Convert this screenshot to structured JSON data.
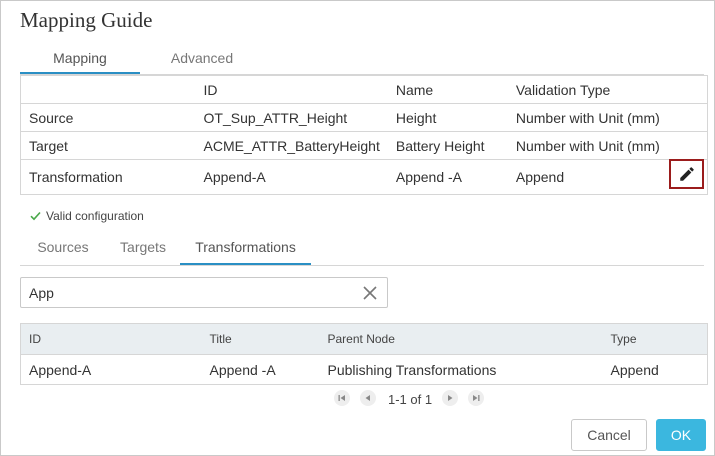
{
  "dialog": {
    "title": "Mapping Guide"
  },
  "top_tabs": [
    {
      "label": "Mapping",
      "active": true
    },
    {
      "label": "Advanced",
      "active": false
    }
  ],
  "summary": {
    "headers": [
      "",
      "ID",
      "Name",
      "Validation Type"
    ],
    "rows": [
      {
        "label": "Source",
        "id": "OT_Sup_ATTR_Height",
        "name": "Height",
        "validation": "Number with Unit (mm)"
      },
      {
        "label": "Target",
        "id": "ACME_ATTR_BatteryHeight",
        "name": "Battery Height",
        "validation": "Number with Unit (mm)"
      },
      {
        "label": "Transformation",
        "id": "Append-A",
        "name": "Append -A",
        "validation": "Append"
      }
    ],
    "edit_icon": "pencil-icon"
  },
  "status": {
    "text": "Valid configuration",
    "icon": "check-icon",
    "color": "#4aa84a"
  },
  "bottom_tabs": [
    {
      "label": "Sources",
      "active": false
    },
    {
      "label": "Targets",
      "active": false
    },
    {
      "label": "Transformations",
      "active": true
    }
  ],
  "search": {
    "value": "App",
    "placeholder": "",
    "clear_icon": "close-icon"
  },
  "results": {
    "headers": [
      "ID",
      "Title",
      "Parent Node",
      "Type"
    ],
    "rows": [
      {
        "id": "Append-A",
        "title": "Append -A",
        "parent": "Publishing Transformations",
        "type": "Append"
      }
    ]
  },
  "pagination": {
    "range": "1-1 of 1"
  },
  "footer": {
    "cancel_label": "Cancel",
    "ok_label": "OK"
  },
  "colors": {
    "accent": "#2a8fc4",
    "ok_button": "#3bb7df",
    "edit_highlight": "#9b1c1c",
    "header_bg": "#e9eef1"
  }
}
